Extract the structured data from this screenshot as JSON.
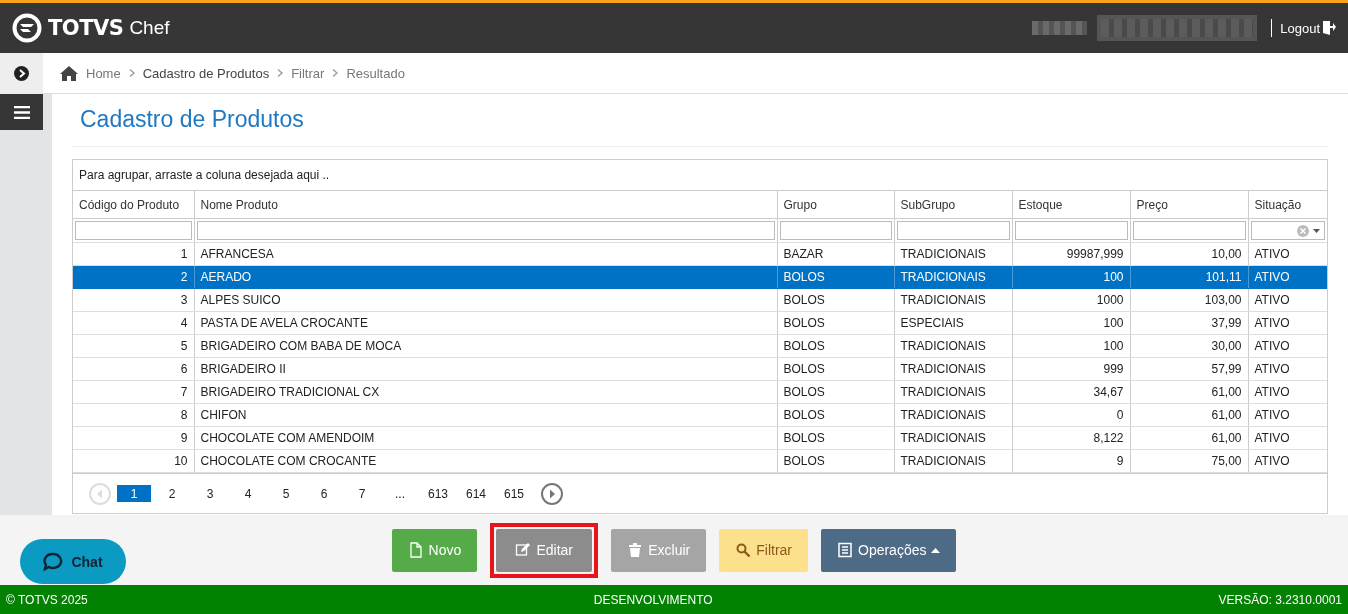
{
  "header": {
    "logo": "TOTVS",
    "logo_suffix": "Chef",
    "logout": "Logout"
  },
  "breadcrumb": [
    {
      "label": "Home",
      "current": false
    },
    {
      "label": "Cadastro de Produtos",
      "current": true
    },
    {
      "label": "Filtrar",
      "current": false
    },
    {
      "label": "Resultado",
      "current": false
    }
  ],
  "page_title": "Cadastro de Produtos",
  "grid": {
    "group_hint": "Para agrupar, arraste a coluna desejada aqui ..",
    "columns": [
      {
        "label": "Código do Produto"
      },
      {
        "label": "Nome Produto"
      },
      {
        "label": "Grupo"
      },
      {
        "label": "SubGrupo"
      },
      {
        "label": "Estoque"
      },
      {
        "label": "Preço"
      },
      {
        "label": "Situação"
      }
    ],
    "rows": [
      {
        "selected": false,
        "cells": [
          "1",
          "AFRANCESA",
          "BAZAR",
          "TRADICIONAIS",
          "99987,999",
          "10,00",
          "ATIVO"
        ]
      },
      {
        "selected": true,
        "cells": [
          "2",
          "AERADO",
          "BOLOS",
          "TRADICIONAIS",
          "100",
          "101,11",
          "ATIVO"
        ]
      },
      {
        "selected": false,
        "cells": [
          "3",
          "ALPES SUICO",
          "BOLOS",
          "TRADICIONAIS",
          "1000",
          "103,00",
          "ATIVO"
        ]
      },
      {
        "selected": false,
        "cells": [
          "4",
          "PASTA DE AVELA CROCANTE",
          "BOLOS",
          "ESPECIAIS",
          "100",
          "37,99",
          "ATIVO"
        ]
      },
      {
        "selected": false,
        "cells": [
          "5",
          "BRIGADEIRO COM BABA DE MOCA",
          "BOLOS",
          "TRADICIONAIS",
          "100",
          "30,00",
          "ATIVO"
        ]
      },
      {
        "selected": false,
        "cells": [
          "6",
          "BRIGADEIRO II",
          "BOLOS",
          "TRADICIONAIS",
          "999",
          "57,99",
          "ATIVO"
        ]
      },
      {
        "selected": false,
        "cells": [
          "7",
          "BRIGADEIRO TRADICIONAL CX",
          "BOLOS",
          "TRADICIONAIS",
          "34,67",
          "61,00",
          "ATIVO"
        ]
      },
      {
        "selected": false,
        "cells": [
          "8",
          "CHIFON",
          "BOLOS",
          "TRADICIONAIS",
          "0",
          "61,00",
          "ATIVO"
        ]
      },
      {
        "selected": false,
        "cells": [
          "9",
          "CHOCOLATE COM AMENDOIM",
          "BOLOS",
          "TRADICIONAIS",
          "8,122",
          "61,00",
          "ATIVO"
        ]
      },
      {
        "selected": false,
        "cells": [
          "10",
          "CHOCOLATE COM CROCANTE",
          "BOLOS",
          "TRADICIONAIS",
          "9",
          "75,00",
          "ATIVO"
        ]
      }
    ],
    "pages": [
      {
        "label": "1",
        "selected": true
      },
      {
        "label": "2",
        "selected": false
      },
      {
        "label": "3",
        "selected": false
      },
      {
        "label": "4",
        "selected": false
      },
      {
        "label": "5",
        "selected": false
      },
      {
        "label": "6",
        "selected": false
      },
      {
        "label": "7",
        "selected": false
      },
      {
        "label": "...",
        "selected": false
      },
      {
        "label": "613",
        "selected": false
      },
      {
        "label": "614",
        "selected": false
      },
      {
        "label": "615",
        "selected": false
      }
    ]
  },
  "actions": [
    {
      "label": "Novo",
      "kind": "new",
      "highlighted": false
    },
    {
      "label": "Editar",
      "kind": "edit",
      "highlighted": true
    },
    {
      "label": "Excluir",
      "kind": "delete",
      "highlighted": false
    },
    {
      "label": "Filtrar",
      "kind": "filter",
      "highlighted": false
    },
    {
      "label": "Operações",
      "kind": "operations",
      "highlighted": false
    }
  ],
  "chat": {
    "label": "Chat"
  },
  "footer": {
    "copyright": "© TOTVS 2025",
    "environment": "DESENVOLVIMENTO",
    "version": "VERSÃO: 3.2310.0001"
  }
}
